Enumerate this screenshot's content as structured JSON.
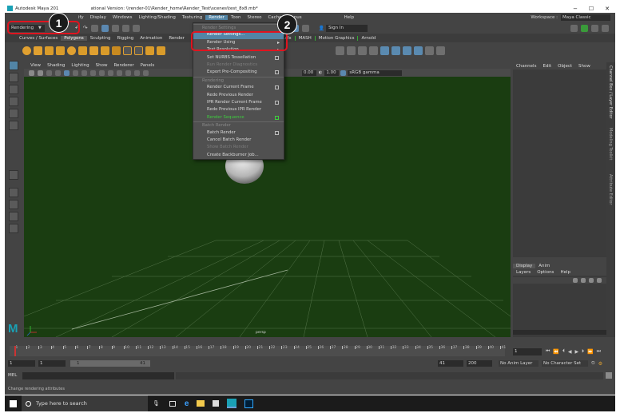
{
  "window": {
    "title": "Autodesk Maya 2017 - Educational Version: \\\\render-01\\Render_home\\Render_Test\\scenes\\test_8x8.mb*",
    "title_visible": "Autodesk Maya 201",
    "title_rest": "ational Version: \\\\render-01\\Render_home\\Render_Test\\scenes\\test_8x8.mb*",
    "minimize": "−",
    "maximize": "☐",
    "close": "✕"
  },
  "menubar": {
    "items": [
      "ify",
      "Display",
      "Windows",
      "Lighting/Shading",
      "Texturing",
      "Render",
      "Toon",
      "Stereo",
      "Cache",
      "Bonus"
    ],
    "help": "Help",
    "workspace_label": "Workspace :",
    "workspace_value": "Maya Classic"
  },
  "statusline": {
    "mode": "Rendering",
    "sign_in": "Sign In"
  },
  "shelf": {
    "tabs": [
      "Curves / Surfaces",
      "Polygons",
      "Sculpting",
      "Rigging",
      "Animation",
      "Render"
    ],
    "right_tabs": [
      "...rfx",
      "MASH",
      "Motion Graphics",
      "Arnold"
    ],
    "active_tab": "Polygons"
  },
  "viewport": {
    "menus": [
      "View",
      "Shading",
      "Lighting",
      "Show",
      "Renderer",
      "Panels"
    ],
    "exposure": "0.00",
    "gamma": "1.00",
    "color_space": "sRGB gamma",
    "camera_label": "persp"
  },
  "render_menu": {
    "items": [
      {
        "label": "Render Settings",
        "section": true
      },
      {
        "label": "Render Settings...",
        "highlight": true
      },
      {
        "label": "Render Using",
        "arrow": true
      },
      {
        "label": "Test Resolution",
        "arrow": true
      },
      {
        "label": "Set NURBS Tessellation",
        "option": true
      },
      {
        "label": "Run Render Diagnostics",
        "disabled": true
      },
      {
        "label": "Export Pre-Compositing",
        "option": true
      },
      {
        "label": "Rendering",
        "section": true
      },
      {
        "label": "Render Current Frame",
        "option": true
      },
      {
        "label": "Redo Previous Render"
      },
      {
        "label": "IPR Render Current Frame",
        "option": true
      },
      {
        "label": "Redo Previous IPR Render"
      },
      {
        "label": "Render Sequence",
        "option": true,
        "green": true
      },
      {
        "label": "Batch Render",
        "section": true
      },
      {
        "label": "Batch Render",
        "option": true
      },
      {
        "label": "Cancel Batch Render"
      },
      {
        "label": "Show Batch Render",
        "disabled": true
      },
      {
        "label": "Create Backburner Job..."
      }
    ]
  },
  "channel_box": {
    "menus": [
      "Channels",
      "Edit",
      "Object",
      "Show"
    ],
    "side_tabs": [
      "Channel Box / Layer Editor",
      "Modeling Toolkit",
      "Attribute Editor"
    ]
  },
  "layer_editor": {
    "tabs": [
      "Display",
      "Anim"
    ],
    "menus": [
      "Layers",
      "Options",
      "Help"
    ]
  },
  "timeline": {
    "ticks": [
      "1",
      "2",
      "3",
      "4",
      "5",
      "6",
      "7",
      "8",
      "9",
      "10",
      "11",
      "12",
      "13",
      "14",
      "15",
      "16",
      "17",
      "18",
      "19",
      "20",
      "21",
      "22",
      "23",
      "24",
      "25",
      "26",
      "27",
      "28",
      "29",
      "30",
      "31",
      "32",
      "33",
      "34",
      "35",
      "36",
      "37",
      "38",
      "39",
      "40",
      "41"
    ],
    "current_frame": "1"
  },
  "range": {
    "start": "1",
    "start2": "1",
    "slider_left": "1",
    "slider_right": "41",
    "end": "41",
    "end2": "200",
    "anim_layer": "No Anim Layer",
    "char_set": "No Character Set"
  },
  "command": {
    "mel": "MEL",
    "help_line": "Change rendering attributes"
  },
  "taskbar": {
    "search_placeholder": "Type here to search"
  },
  "callouts": {
    "one": "1",
    "two": "2"
  }
}
